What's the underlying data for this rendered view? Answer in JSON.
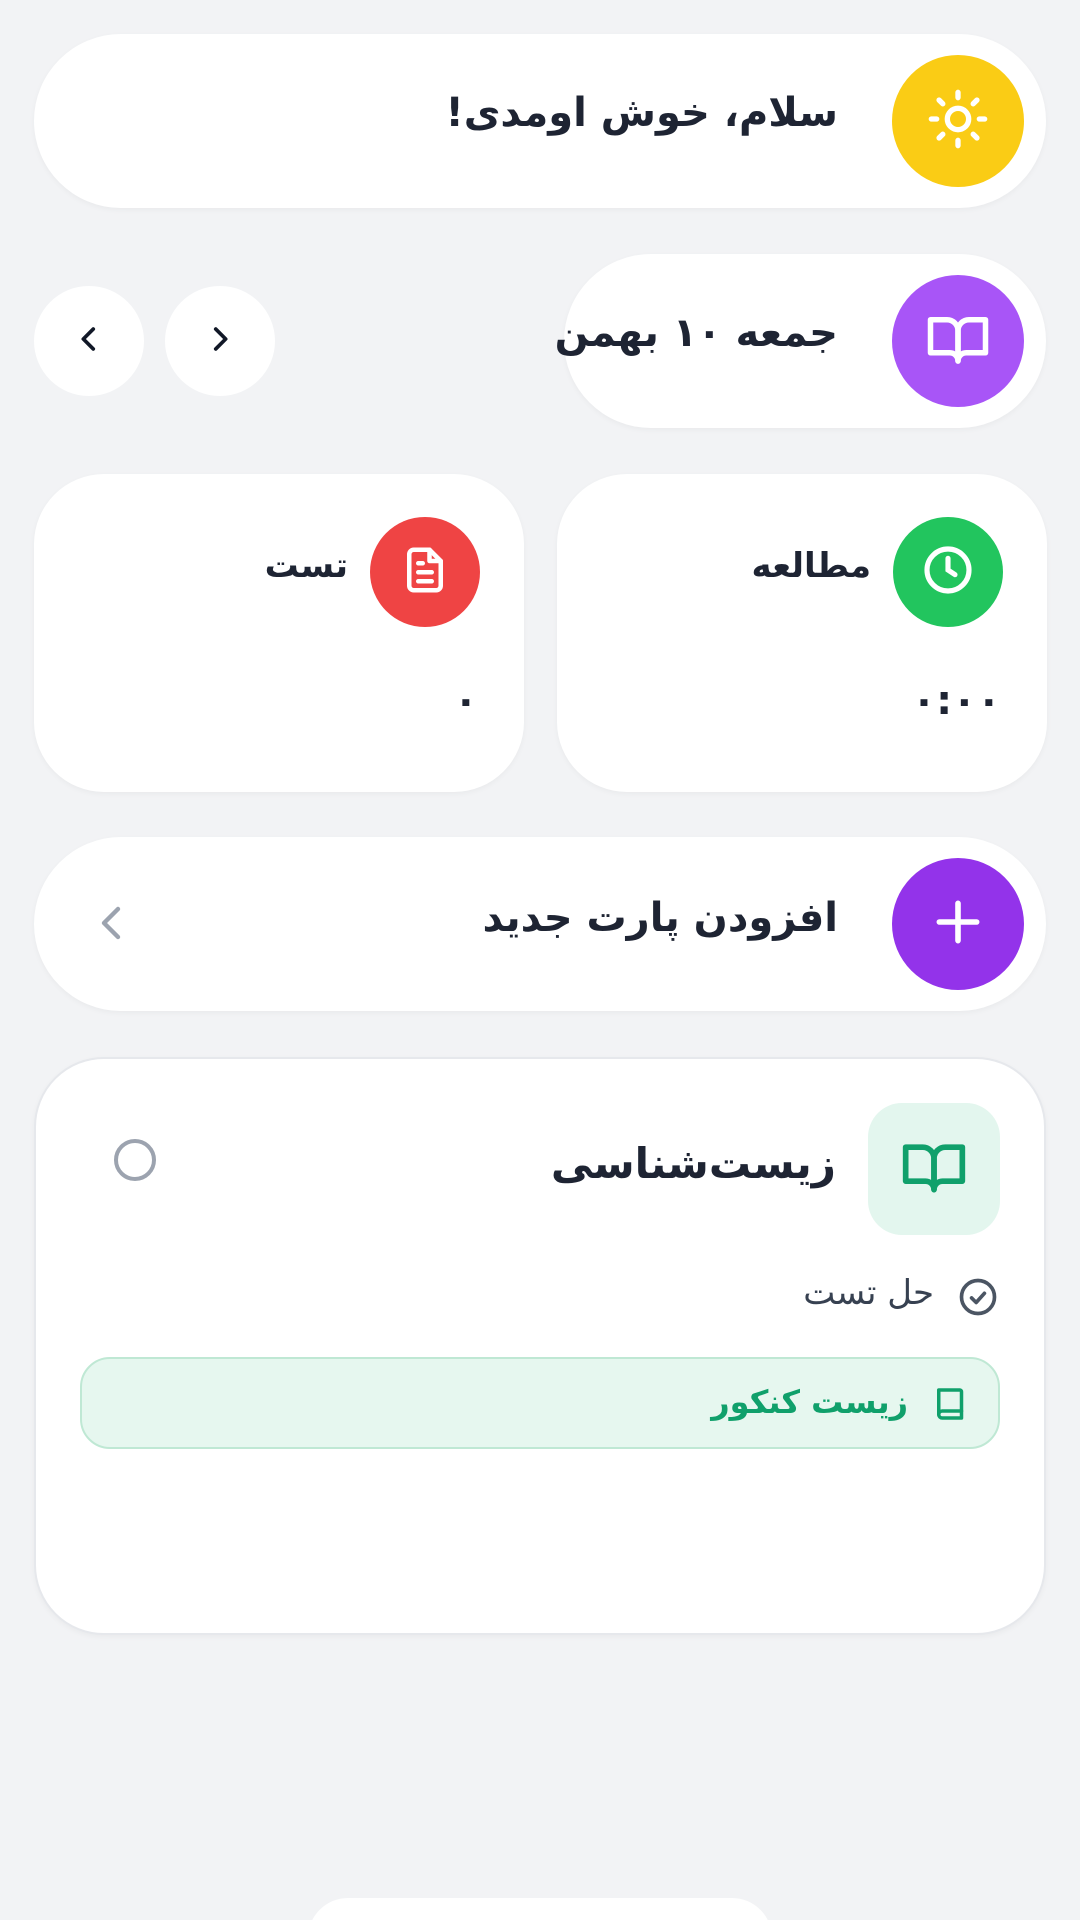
{
  "greeting": {
    "text": "سلام، خوش اومدی!",
    "icon": "sun-icon"
  },
  "date": {
    "text": "جمعه ۱۰ بهمن",
    "icon": "book-open-icon"
  },
  "nav": {
    "prev_icon": "chevron-left-icon",
    "next_icon": "chevron-right-icon"
  },
  "stats": {
    "study": {
      "label": "مطالعه",
      "value": "۰:۰۰",
      "icon": "clock-icon",
      "color": "#22c55e"
    },
    "test": {
      "label": "تست",
      "value": "۰",
      "icon": "document-icon",
      "color": "#ef4444"
    }
  },
  "add_part": {
    "label": "افزودن پارت جدید",
    "icon": "plus-icon"
  },
  "subject": {
    "title": "زیست‌شناسی",
    "task": "حل تست",
    "tag": "زیست کنکور"
  },
  "colors": {
    "background": "#f2f3f5",
    "yellow": "#facc15",
    "purple": "#a855f7",
    "purple_dark": "#9333ea",
    "green": "#10a06b"
  }
}
